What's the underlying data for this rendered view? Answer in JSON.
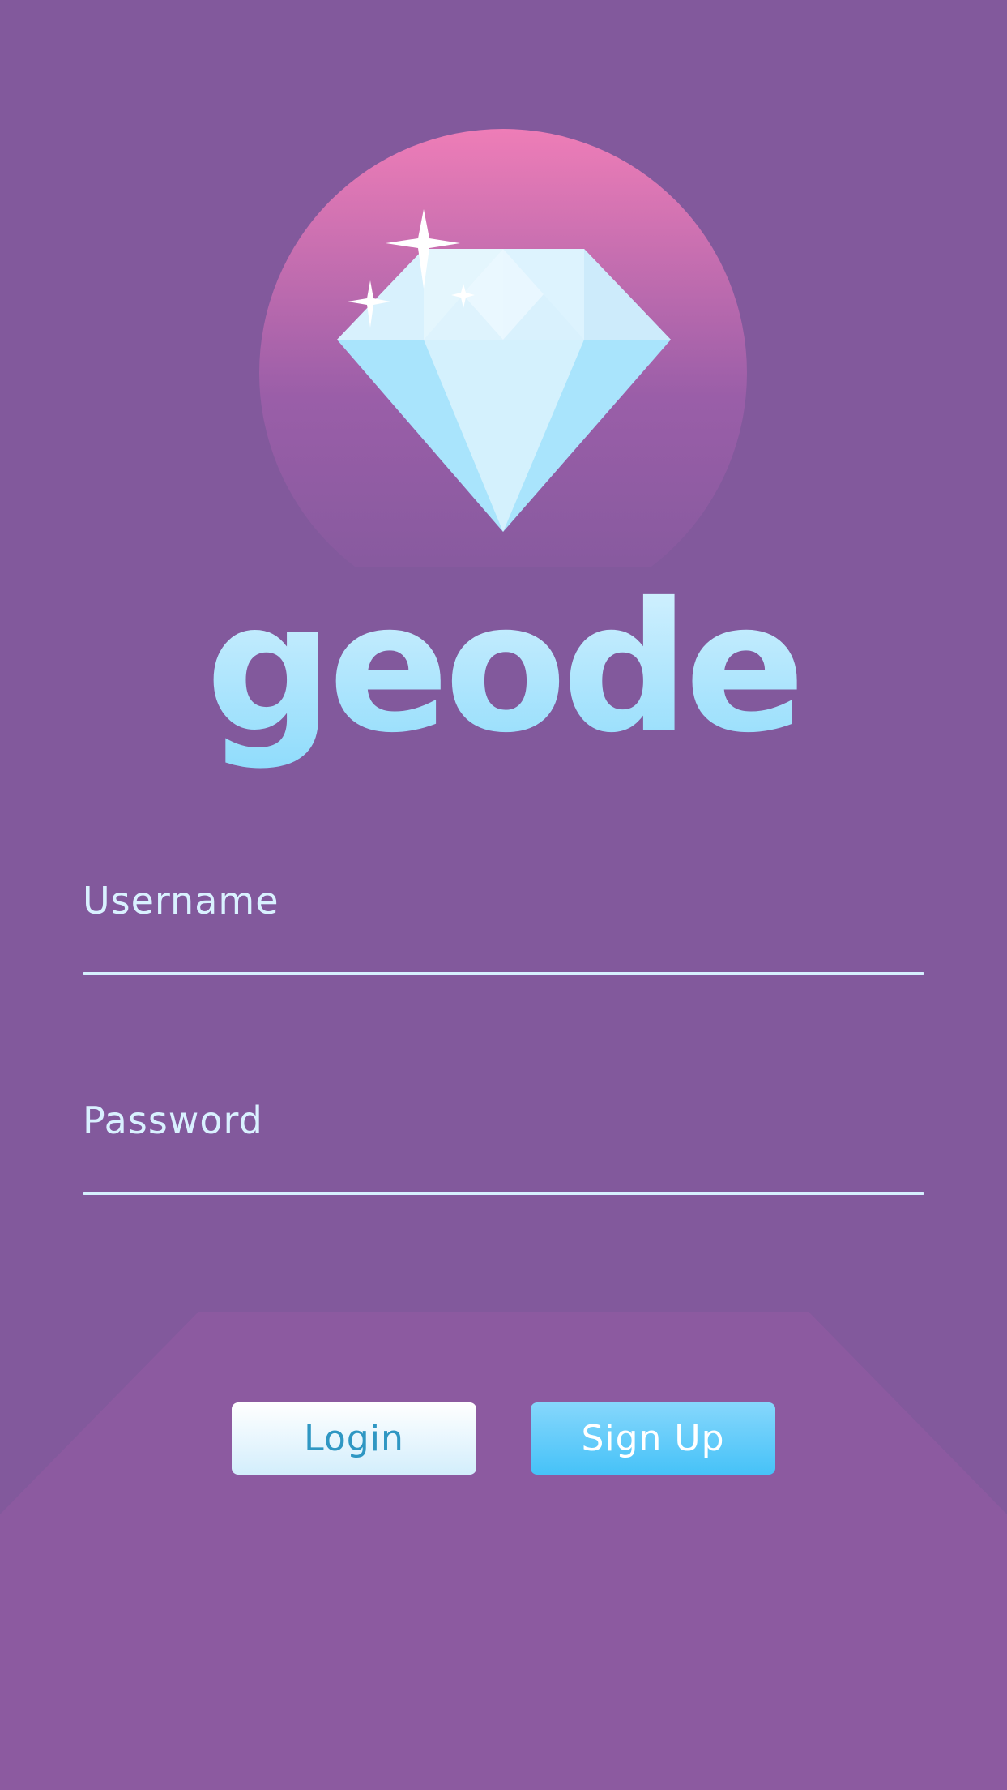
{
  "app": {
    "name": "geode"
  },
  "form": {
    "username": {
      "label": "Username",
      "value": ""
    },
    "password": {
      "label": "Password",
      "value": ""
    }
  },
  "actions": {
    "login_label": "Login",
    "signup_label": "Sign Up"
  },
  "icons": {
    "logo": "diamond-icon",
    "sparkles": "sparkle-icon"
  },
  "colors": {
    "background": "#82599c",
    "bottom_panel": "#8c5aa0",
    "circle_top": "#ee7db7",
    "diamond": "#a9e4fc",
    "text_accent": "#d9f1ff",
    "login_button": "#ffffff",
    "login_text": "#2f97c3",
    "signup_button": "#46c2f8",
    "signup_text": "#ffffff"
  }
}
